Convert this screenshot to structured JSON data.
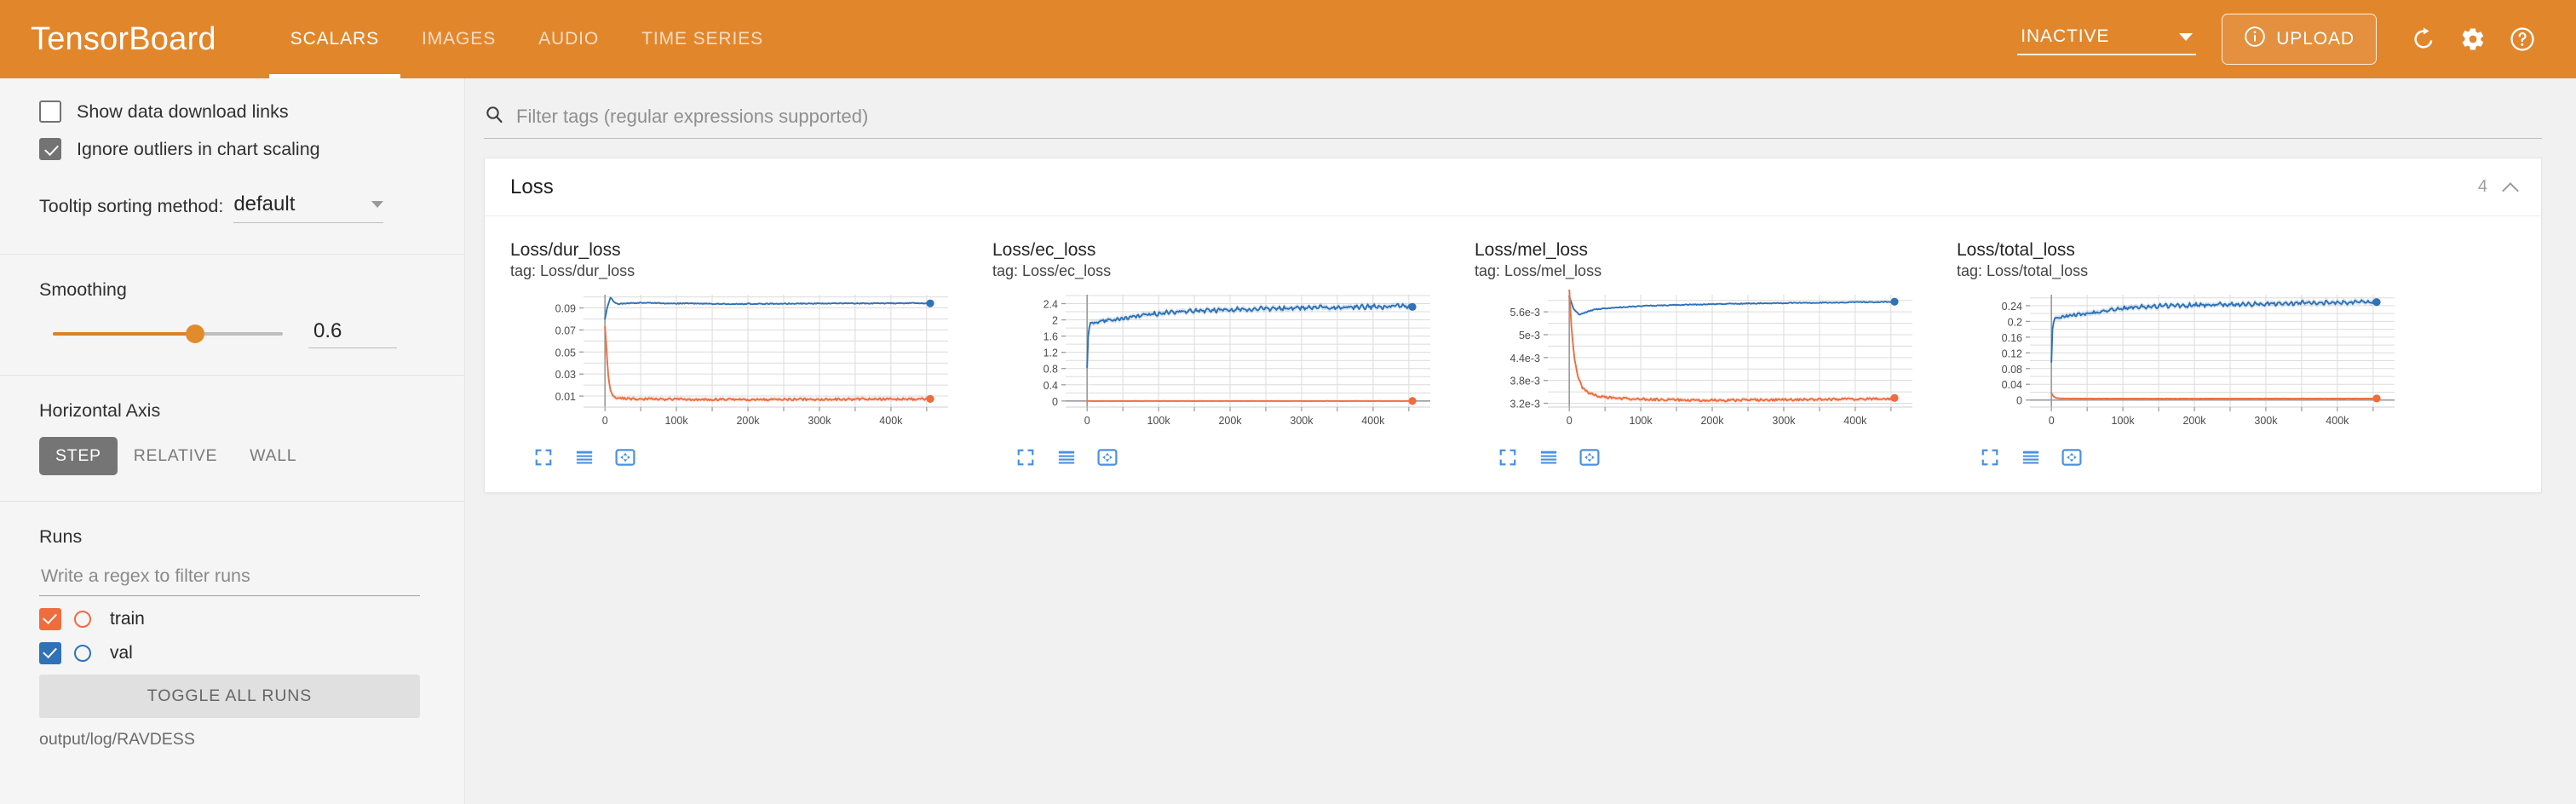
{
  "app": {
    "brand": "TensorBoard",
    "tabs": [
      {
        "label": "SCALARS",
        "active": true
      },
      {
        "label": "IMAGES",
        "active": false
      },
      {
        "label": "AUDIO",
        "active": false
      },
      {
        "label": "TIME SERIES",
        "active": false
      }
    ],
    "status_select": "INACTIVE",
    "upload_label": "UPLOAD",
    "icons": {
      "upload_info": "info-icon",
      "refresh": "refresh-icon",
      "settings": "gear-icon",
      "help": "help-circle-icon"
    },
    "accent_orange": "#e2862c",
    "run_train_color": "#ef6c3e",
    "run_val_color": "#2f72b8",
    "tool_blue": "#4a90e2"
  },
  "sidebar": {
    "show_download_links": {
      "label": "Show data download links",
      "checked": false
    },
    "ignore_outliers": {
      "label": "Ignore outliers in chart scaling",
      "checked": true
    },
    "tooltip_sorting": {
      "label": "Tooltip sorting method:",
      "value": "default"
    },
    "smoothing": {
      "title": "Smoothing",
      "value": "0.6",
      "fraction": 0.6
    },
    "horizontal_axis": {
      "title": "Horizontal Axis",
      "options": [
        {
          "label": "STEP",
          "active": true
        },
        {
          "label": "RELATIVE",
          "active": false
        },
        {
          "label": "WALL",
          "active": false
        }
      ]
    },
    "runs": {
      "title": "Runs",
      "filter_placeholder": "Write a regex to filter runs",
      "filter_value": "",
      "items": [
        {
          "name": "train",
          "checked": true,
          "color": "#ef6c3e"
        },
        {
          "name": "val",
          "checked": true,
          "color": "#2f72b8"
        }
      ],
      "toggle_all_label": "TOGGLE ALL RUNS",
      "logdir": "output/log/RAVDESS"
    }
  },
  "main": {
    "search": {
      "placeholder": "Filter tags (regular expressions supported)",
      "value": "",
      "icon": "search-icon"
    },
    "card": {
      "title": "Loss",
      "count": "4",
      "collapse_icon": "chevron-up-icon"
    }
  },
  "chart_data": [
    {
      "type": "line",
      "title": "Loss/dur_loss",
      "subtitle": "tag: Loss/dur_loss",
      "xlabel": "",
      "ylabel": "",
      "xticks": [
        "0",
        "100k",
        "200k",
        "300k",
        "400k"
      ],
      "xtick_values": [
        0,
        100000,
        200000,
        300000,
        400000
      ],
      "yticks": [
        "0.01",
        "0.03",
        "0.05",
        "0.07",
        "0.09"
      ],
      "ytick_values": [
        0.01,
        0.03,
        0.05,
        0.07,
        0.09
      ],
      "xlim": [
        -30000,
        480000
      ],
      "ylim": [
        0.0,
        0.102
      ],
      "grid": true,
      "legend": "none",
      "series": [
        {
          "name": "val",
          "color": "#2f72b8",
          "x": [
            0,
            3000,
            8000,
            12000,
            18000,
            25000,
            35000,
            50000,
            70000,
            90000,
            110000,
            140000,
            170000,
            200000,
            240000,
            280000,
            320000,
            360000,
            400000,
            440000,
            455000
          ],
          "y": [
            0.08,
            0.09,
            0.1,
            0.0955,
            0.0935,
            0.0938,
            0.0942,
            0.0946,
            0.0944,
            0.094,
            0.0941,
            0.0938,
            0.0936,
            0.0937,
            0.0938,
            0.0939,
            0.094,
            0.0941,
            0.0942,
            0.0943,
            0.0943
          ]
        },
        {
          "name": "train",
          "color": "#ef6c3e",
          "x": [
            0,
            2000,
            4000,
            7000,
            10000,
            14000,
            20000,
            30000,
            50000,
            80000,
            120000,
            170000,
            220000,
            280000,
            340000,
            400000,
            440000,
            455000
          ],
          "y": [
            0.073,
            0.055,
            0.032,
            0.017,
            0.0115,
            0.009,
            0.008,
            0.0076,
            0.0073,
            0.0071,
            0.007,
            0.0069,
            0.0069,
            0.007,
            0.0071,
            0.0072,
            0.0073,
            0.0073
          ]
        }
      ]
    },
    {
      "type": "line",
      "title": "Loss/ec_loss",
      "subtitle": "tag: Loss/ec_loss",
      "xlabel": "",
      "ylabel": "",
      "xticks": [
        "0",
        "100k",
        "200k",
        "300k",
        "400k"
      ],
      "xtick_values": [
        0,
        100000,
        200000,
        300000,
        400000
      ],
      "yticks": [
        "0",
        "0.4",
        "0.8",
        "1.2",
        "1.6",
        "2",
        "2.4"
      ],
      "ytick_values": [
        0,
        0.4,
        0.8,
        1.2,
        1.6,
        2.0,
        2.4
      ],
      "xlim": [
        -30000,
        480000
      ],
      "ylim": [
        -0.15,
        2.62
      ],
      "grid": true,
      "legend": "none",
      "series": [
        {
          "name": "val",
          "color": "#2f72b8",
          "x": [
            0,
            1500,
            4000,
            8000,
            16000,
            30000,
            50000,
            70000,
            90000,
            120000,
            160000,
            200000,
            250000,
            300000,
            350000,
            400000,
            440000,
            455000
          ],
          "y": [
            0.83,
            1.6,
            1.93,
            1.92,
            1.95,
            1.99,
            2.03,
            2.09,
            2.14,
            2.19,
            2.23,
            2.25,
            2.27,
            2.29,
            2.31,
            2.32,
            2.34,
            2.34
          ]
        },
        {
          "name": "train",
          "color": "#ef6c3e",
          "x": [
            0,
            50000,
            150000,
            250000,
            350000,
            455000
          ],
          "y": [
            0.0,
            0.0,
            0.0,
            0.0,
            0.0,
            0.0
          ]
        }
      ]
    },
    {
      "type": "line",
      "title": "Loss/mel_loss",
      "subtitle": "tag: Loss/mel_loss",
      "xlabel": "",
      "ylabel": "",
      "xticks": [
        "0",
        "100k",
        "200k",
        "300k",
        "400k"
      ],
      "xtick_values": [
        0,
        100000,
        200000,
        300000,
        400000
      ],
      "yticks": [
        "3.2e-3",
        "3.8e-3",
        "4.4e-3",
        "5e-3",
        "5.6e-3"
      ],
      "ytick_values": [
        0.0032,
        0.0038,
        0.0044,
        0.005,
        0.0056
      ],
      "xlim": [
        -30000,
        480000
      ],
      "ylim": [
        0.0031,
        0.00605
      ],
      "grid": true,
      "legend": "none",
      "series": [
        {
          "name": "val",
          "color": "#2f72b8",
          "x": [
            0,
            6000,
            14000,
            22000,
            35000,
            55000,
            80000,
            110000,
            150000,
            200000,
            250000,
            300000,
            350000,
            400000,
            440000,
            455000
          ],
          "y": [
            0.006,
            0.00568,
            0.00552,
            0.00558,
            0.00566,
            0.0057,
            0.00573,
            0.00576,
            0.00578,
            0.0058,
            0.00582,
            0.00583,
            0.00584,
            0.00585,
            0.00586,
            0.00586
          ]
        },
        {
          "name": "train",
          "color": "#ef6c3e",
          "x": [
            0,
            3000,
            7000,
            12000,
            18000,
            26000,
            38000,
            55000,
            80000,
            120000,
            170000,
            230000,
            290000,
            350000,
            410000,
            455000
          ],
          "y": [
            0.0062,
            0.0052,
            0.0044,
            0.0039,
            0.00362,
            0.00348,
            0.0034,
            0.00335,
            0.00332,
            0.0033,
            0.00328,
            0.00328,
            0.00329,
            0.0033,
            0.00331,
            0.00332
          ]
        }
      ]
    },
    {
      "type": "line",
      "title": "Loss/total_loss",
      "subtitle": "tag: Loss/total_loss",
      "xlabel": "",
      "ylabel": "",
      "xticks": [
        "0",
        "100k",
        "200k",
        "300k",
        "400k"
      ],
      "xtick_values": [
        0,
        100000,
        200000,
        300000,
        400000
      ],
      "yticks": [
        "0",
        "0.04",
        "0.08",
        "0.12",
        "0.16",
        "0.2",
        "0.24"
      ],
      "ytick_values": [
        0,
        0.04,
        0.08,
        0.12,
        0.16,
        0.2,
        0.24
      ],
      "xlim": [
        -30000,
        480000
      ],
      "ylim": [
        -0.018,
        0.268
      ],
      "grid": true,
      "legend": "none",
      "series": [
        {
          "name": "val",
          "color": "#2f72b8",
          "x": [
            0,
            1500,
            4000,
            8000,
            16000,
            30000,
            50000,
            70000,
            90000,
            120000,
            160000,
            200000,
            250000,
            300000,
            350000,
            400000,
            440000,
            455000
          ],
          "y": [
            0.097,
            0.18,
            0.208,
            0.209,
            0.212,
            0.216,
            0.22,
            0.226,
            0.231,
            0.236,
            0.239,
            0.241,
            0.243,
            0.245,
            0.247,
            0.248,
            0.25,
            0.25
          ]
        },
        {
          "name": "train",
          "color": "#ef6c3e",
          "x": [
            0,
            3000,
            7000,
            14000,
            30000,
            60000,
            120000,
            200000,
            300000,
            400000,
            455000
          ],
          "y": [
            0.0175,
            0.009,
            0.005,
            0.004,
            0.0038,
            0.0037,
            0.0036,
            0.0036,
            0.0037,
            0.0038,
            0.0039
          ]
        }
      ]
    }
  ],
  "chart_tools": [
    {
      "icon": "fullscreen-icon",
      "name": "expand"
    },
    {
      "icon": "data-table-icon",
      "name": "toggle-y-axis"
    },
    {
      "icon": "pan-reset-icon",
      "name": "reset-domain"
    }
  ]
}
